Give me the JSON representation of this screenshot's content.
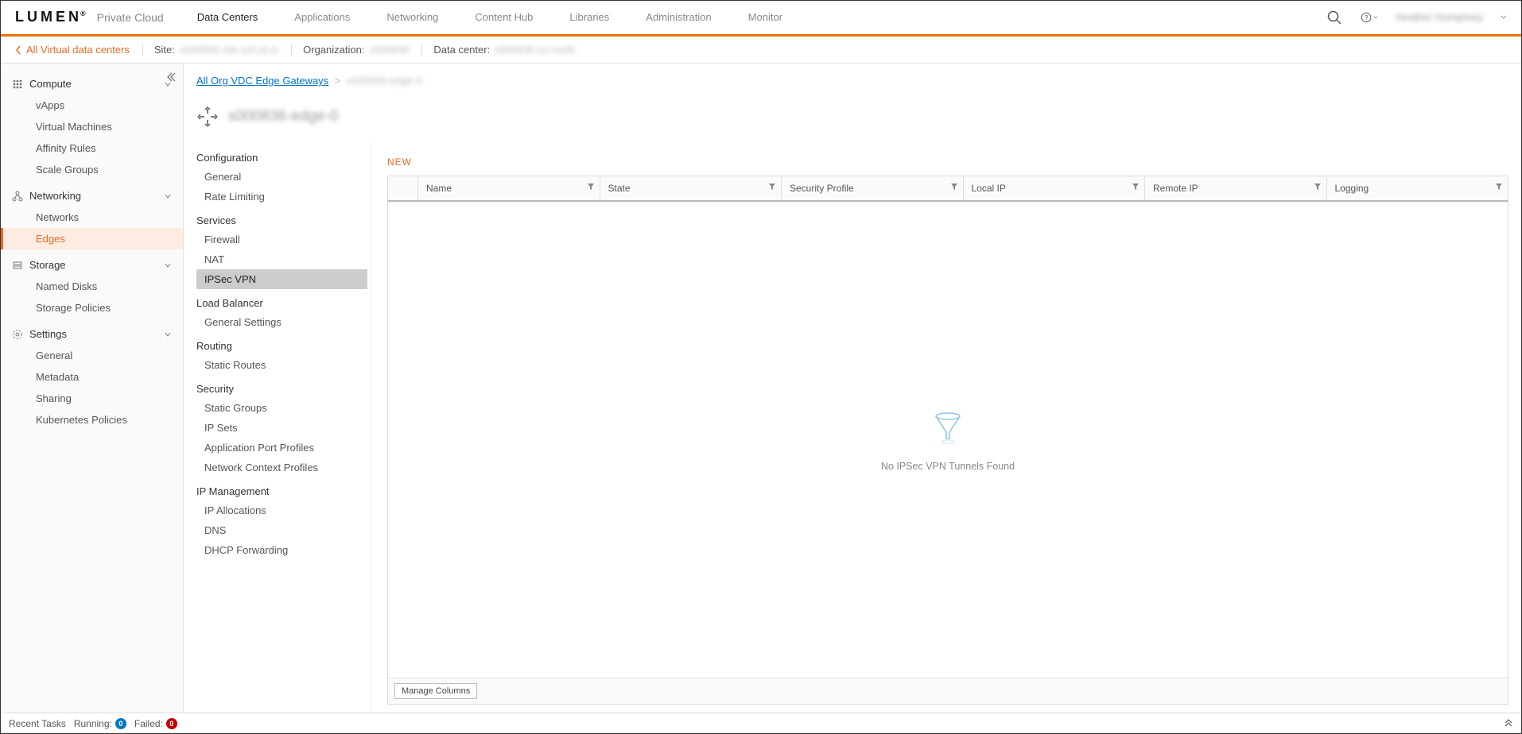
{
  "brand": "LUMEN",
  "app_name": "Private Cloud",
  "topnav": {
    "items": [
      "Data Centers",
      "Applications",
      "Networking",
      "Content Hub",
      "Libraries",
      "Administration",
      "Monitor"
    ],
    "active_index": 0
  },
  "user_name_blurred": "Heather Humphrey",
  "breadcrumb_bar": {
    "back_label": "All Virtual data centers",
    "segments": [
      {
        "label": "Site:",
        "value": "s000836.site.vcf.ctl.io"
      },
      {
        "label": "Organization:",
        "value": "s000836"
      },
      {
        "label": "Data center:",
        "value": "s000836.us-north"
      }
    ]
  },
  "left_nav": {
    "sections": [
      {
        "title": "Compute",
        "icon": "grid-icon",
        "items": [
          "vApps",
          "Virtual Machines",
          "Affinity Rules",
          "Scale Groups"
        ]
      },
      {
        "title": "Networking",
        "icon": "network-icon",
        "items": [
          "Networks",
          "Edges"
        ],
        "active_item": 1
      },
      {
        "title": "Storage",
        "icon": "storage-icon",
        "items": [
          "Named Disks",
          "Storage Policies"
        ]
      },
      {
        "title": "Settings",
        "icon": "gear-icon",
        "items": [
          "General",
          "Metadata",
          "Sharing",
          "Kubernetes Policies"
        ]
      }
    ]
  },
  "breadcrumb2": {
    "link": "All Org VDC Edge Gateways",
    "sep": ">",
    "current": "s000836-edge-0"
  },
  "page_title": "s000836-edge-0",
  "mid_nav": {
    "sections": [
      {
        "title": "Configuration",
        "items": [
          "General",
          "Rate Limiting"
        ]
      },
      {
        "title": "Services",
        "items": [
          "Firewall",
          "NAT",
          "IPSec VPN"
        ],
        "active_item": 2
      },
      {
        "title": "Load Balancer",
        "items": [
          "General Settings"
        ]
      },
      {
        "title": "Routing",
        "items": [
          "Static Routes"
        ]
      },
      {
        "title": "Security",
        "items": [
          "Static Groups",
          "IP Sets",
          "Application Port Profiles",
          "Network Context Profiles"
        ]
      },
      {
        "title": "IP Management",
        "items": [
          "IP Allocations",
          "DNS",
          "DHCP Forwarding"
        ]
      }
    ]
  },
  "actions": {
    "new": "NEW"
  },
  "grid": {
    "columns": [
      "Name",
      "State",
      "Security Profile",
      "Local IP",
      "Remote IP",
      "Logging"
    ],
    "empty_message": "No IPSec VPN Tunnels Found",
    "manage_columns": "Manage Columns"
  },
  "bottom_bar": {
    "recent_tasks": "Recent Tasks",
    "running_label": "Running:",
    "running_count": "0",
    "failed_label": "Failed:",
    "failed_count": "0"
  }
}
